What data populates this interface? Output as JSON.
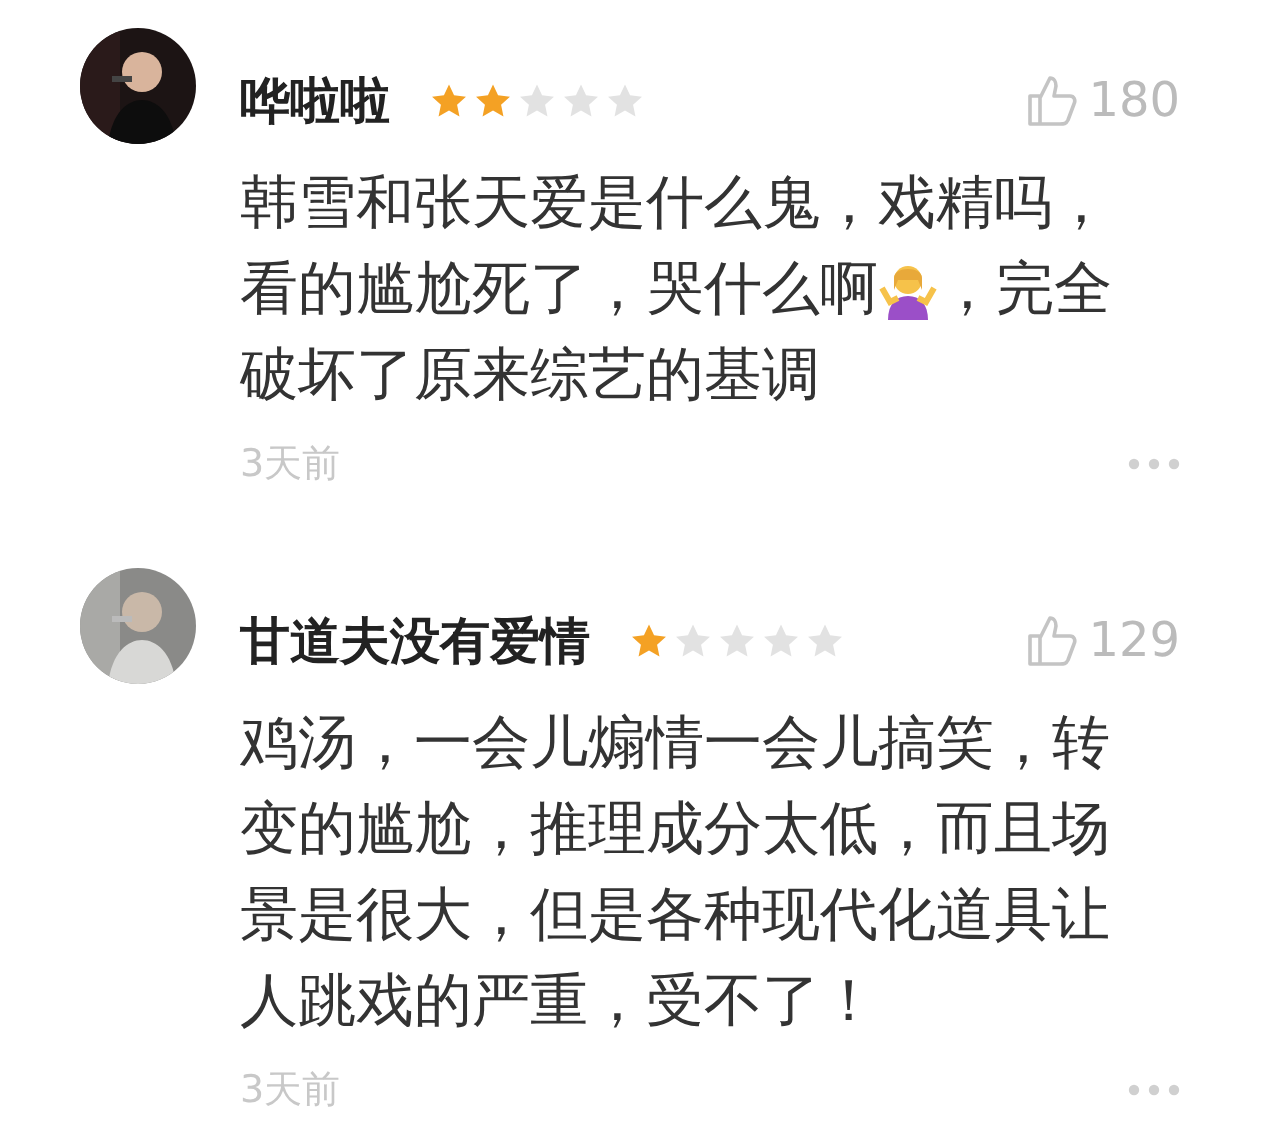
{
  "comments": [
    {
      "user": "哗啦啦",
      "stars": 2,
      "likes": "180",
      "lines": [
        [
          {
            "kind": "text",
            "text": "韩雪和张天爱是什么鬼，戏精吗，"
          }
        ],
        [
          {
            "kind": "text",
            "text": "看的尴尬死了，哭什么啊"
          },
          {
            "kind": "emoji"
          },
          {
            "kind": "text",
            "text": "，完全"
          }
        ],
        [
          {
            "kind": "text",
            "text": "破坏了原来综艺的基调"
          }
        ]
      ],
      "time": "3天前"
    },
    {
      "user": "甘道夫没有爱情",
      "stars": 1,
      "likes": "129",
      "lines": [
        [
          {
            "kind": "text",
            "text": "鸡汤，一会儿煽情一会儿搞笑，转"
          }
        ],
        [
          {
            "kind": "text",
            "text": "变的尴尬，推理成分太低，而且场"
          }
        ],
        [
          {
            "kind": "text",
            "text": "景是很大，但是各种现代化道具让"
          }
        ],
        [
          {
            "kind": "text",
            "text": "人跳戏的严重，受不了！"
          }
        ]
      ],
      "time": "3天前"
    }
  ]
}
